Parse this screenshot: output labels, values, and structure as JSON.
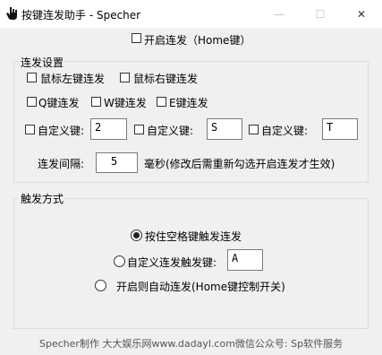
{
  "window": {
    "title": "按键连发助手 - Specher",
    "minimize_glyph": "—",
    "maximize_glyph": "☐",
    "close_glyph": "✕",
    "app_icon": "hand-cursor-icon"
  },
  "master": {
    "label": "开启连发（Home键）",
    "checked": false
  },
  "settings": {
    "legend": "连发设置",
    "left_click": "鼠标左键连发",
    "right_click": "鼠标右键连发",
    "q_key": "Q键连发",
    "w_key": "W键连发",
    "e_key": "E键连发",
    "custom_label": "自定义键:",
    "custom1_value": "2",
    "custom2_value": "S",
    "custom3_value": "T",
    "interval_label": "连发间隔:",
    "interval_value": "5",
    "interval_unit": "毫秒(修改后需重新勾选开启连发才生效)"
  },
  "trigger": {
    "legend": "触发方式",
    "opt_space": "按住空格键触发连发",
    "opt_custom": "自定义连发触发键:",
    "opt_custom_value": "A",
    "opt_auto": "开启则自动连发(Home键控制开关)",
    "selected": "space"
  },
  "footer": {
    "text": "Specher制作 大大娱乐网www.dadayl.com微信公众号: Sp软件服务"
  },
  "colors": {
    "window_bg": "#f0f0f0",
    "titlebar_bg": "#ffffff",
    "group_border": "#dcdcdc"
  }
}
